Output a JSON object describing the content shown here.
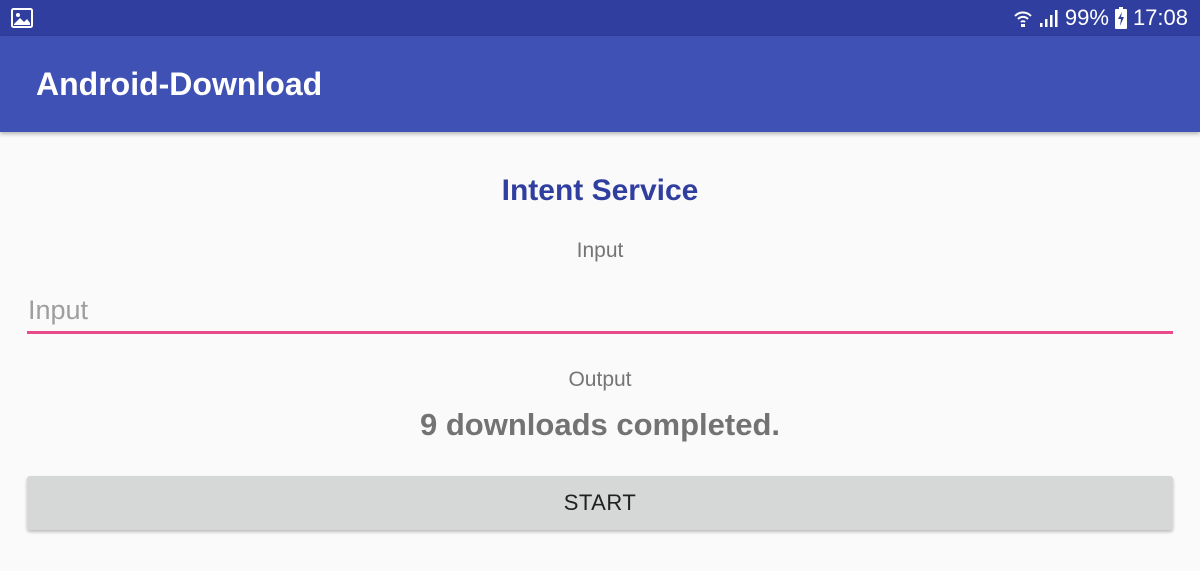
{
  "status_bar": {
    "left_icon": "image-notification-icon",
    "wifi_icon": "wifi-icon",
    "signal_icon": "signal-icon",
    "battery_percent": "99%",
    "battery_icon": "battery-charging-icon",
    "time": "17:08"
  },
  "app_bar": {
    "title": "Android-Download"
  },
  "main": {
    "section_title": "Intent Service",
    "input_label": "Input",
    "input_placeholder": "Input",
    "input_value": "",
    "output_label": "Output",
    "output_value": "9 downloads completed.",
    "start_button_label": "START"
  },
  "colors": {
    "status_bar": "#303f9f",
    "app_bar": "#3f51b5",
    "accent": "#e84a8a",
    "section_title": "#303f9f",
    "button": "#d6d7d7"
  }
}
